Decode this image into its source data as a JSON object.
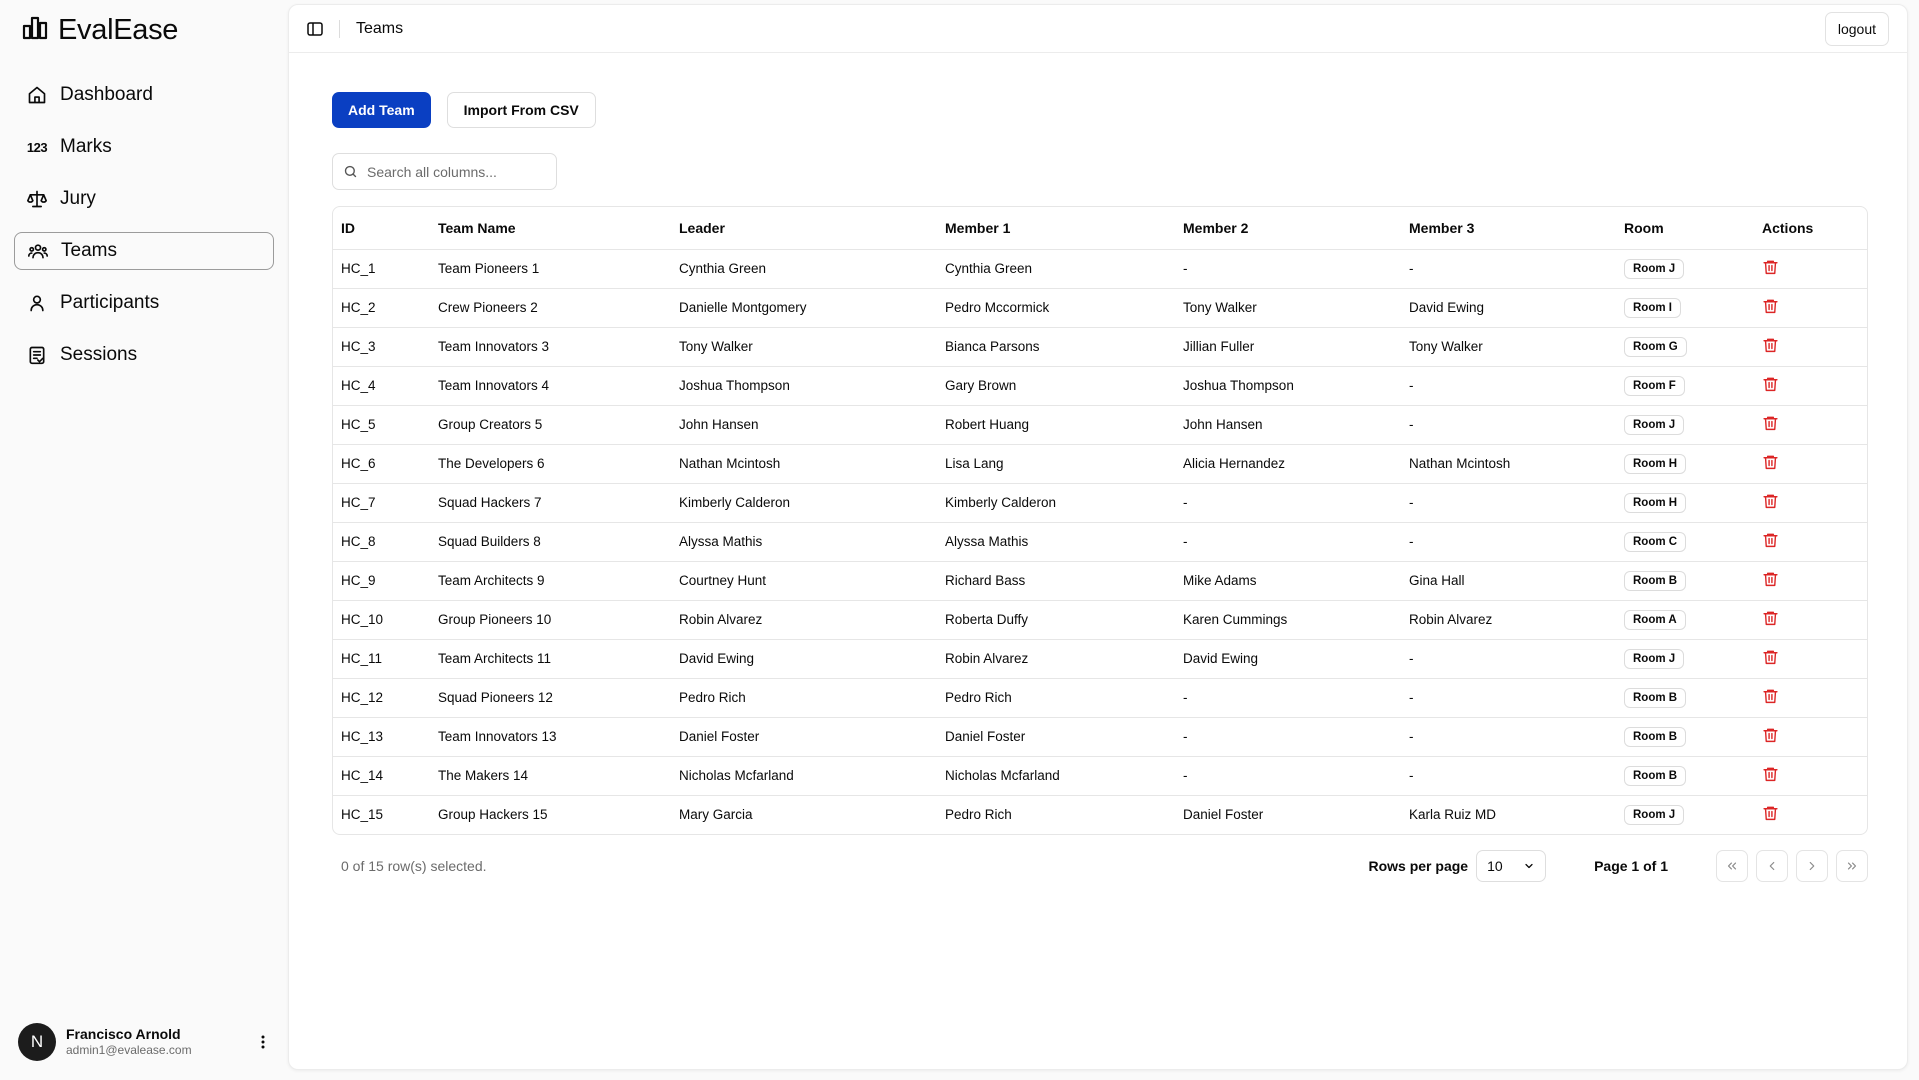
{
  "brand": {
    "name": "EvalEase"
  },
  "sidebar": {
    "items": [
      {
        "label": "Dashboard",
        "icon": "home-icon"
      },
      {
        "label": "Marks",
        "icon": "numbers-icon"
      },
      {
        "label": "Jury",
        "icon": "scale-icon"
      },
      {
        "label": "Teams",
        "icon": "users-icon",
        "active": true
      },
      {
        "label": "Participants",
        "icon": "user-icon"
      },
      {
        "label": "Sessions",
        "icon": "clipboard-icon"
      }
    ],
    "numbers_glyph": "123"
  },
  "user": {
    "initial": "N",
    "name": "Francisco Arnold",
    "email": "admin1@evalease.com"
  },
  "header": {
    "title": "Teams",
    "logout_label": "logout"
  },
  "toolbar": {
    "add_label": "Add Team",
    "import_label": "Import From CSV"
  },
  "search": {
    "placeholder": "Search all columns..."
  },
  "table": {
    "headers": [
      "ID",
      "Team Name",
      "Leader",
      "Member 1",
      "Member 2",
      "Member 3",
      "Room",
      "Actions"
    ],
    "rows": [
      [
        "HC_1",
        "Team Pioneers 1",
        "Cynthia Green",
        "Cynthia Green",
        "-",
        "-",
        "Room J"
      ],
      [
        "HC_2",
        "Crew Pioneers 2",
        "Danielle Montgomery",
        "Pedro Mccormick",
        "Tony Walker",
        "David Ewing",
        "Room I"
      ],
      [
        "HC_3",
        "Team Innovators 3",
        "Tony Walker",
        "Bianca Parsons",
        "Jillian Fuller",
        "Tony Walker",
        "Room G"
      ],
      [
        "HC_4",
        "Team Innovators 4",
        "Joshua Thompson",
        "Gary Brown",
        "Joshua Thompson",
        "-",
        "Room F"
      ],
      [
        "HC_5",
        "Group Creators 5",
        "John Hansen",
        "Robert Huang",
        "John Hansen",
        "-",
        "Room J"
      ],
      [
        "HC_6",
        "The Developers 6",
        "Nathan Mcintosh",
        "Lisa Lang",
        "Alicia Hernandez",
        "Nathan Mcintosh",
        "Room H"
      ],
      [
        "HC_7",
        "Squad Hackers 7",
        "Kimberly Calderon",
        "Kimberly Calderon",
        "-",
        "-",
        "Room H"
      ],
      [
        "HC_8",
        "Squad Builders 8",
        "Alyssa Mathis",
        "Alyssa Mathis",
        "-",
        "-",
        "Room C"
      ],
      [
        "HC_9",
        "Team Architects 9",
        "Courtney Hunt",
        "Richard Bass",
        "Mike Adams",
        "Gina Hall",
        "Room B"
      ],
      [
        "HC_10",
        "Group Pioneers 10",
        "Robin Alvarez",
        "Roberta Duffy",
        "Karen Cummings",
        "Robin Alvarez",
        "Room A"
      ],
      [
        "HC_11",
        "Team Architects 11",
        "David Ewing",
        "Robin Alvarez",
        "David Ewing",
        "-",
        "Room J"
      ],
      [
        "HC_12",
        "Squad Pioneers 12",
        "Pedro Rich",
        "Pedro Rich",
        "-",
        "-",
        "Room B"
      ],
      [
        "HC_13",
        "Team Innovators 13",
        "Daniel Foster",
        "Daniel Foster",
        "-",
        "-",
        "Room B"
      ],
      [
        "HC_14",
        "The Makers 14",
        "Nicholas Mcfarland",
        "Nicholas Mcfarland",
        "-",
        "-",
        "Room B"
      ],
      [
        "HC_15",
        "Group Hackers 15",
        "Mary Garcia",
        "Pedro Rich",
        "Daniel Foster",
        "Karla Ruiz MD",
        "Room J"
      ]
    ]
  },
  "footer": {
    "selected_text": "0 of 15 row(s) selected.",
    "rows_per_page_label": "Rows per page",
    "rows_per_page_value": "10",
    "page_info": "Page 1 of 1"
  },
  "colors": {
    "primary": "#0a3fc2",
    "danger": "#dc2626",
    "avatar_bg": "#1c1c1c"
  }
}
